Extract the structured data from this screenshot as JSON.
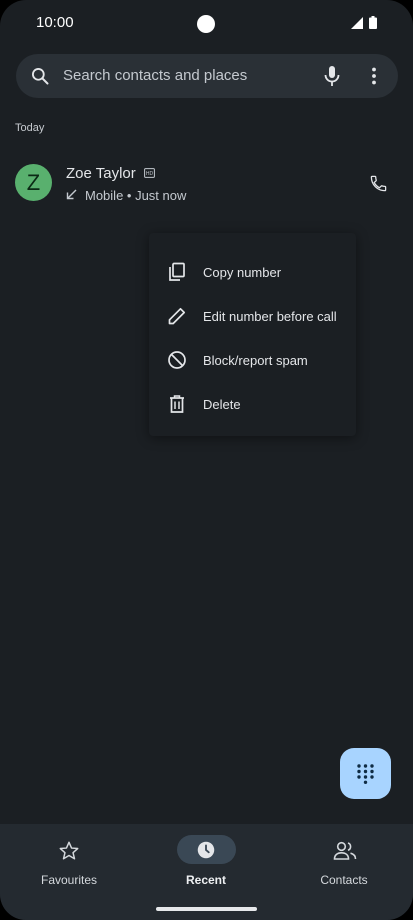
{
  "status_bar": {
    "time": "10:00"
  },
  "search": {
    "placeholder": "Search contacts and places"
  },
  "section": {
    "header": "Today"
  },
  "call_log": {
    "entries": [
      {
        "avatar_letter": "Z",
        "name": "Zoe Taylor",
        "type": "Mobile",
        "time": "Just now",
        "detail": "Mobile • Just now",
        "direction_icon": "incoming-call-arrow"
      }
    ]
  },
  "context_menu": {
    "items": [
      {
        "label": "Copy number",
        "icon": "copy-icon"
      },
      {
        "label": "Edit number before call",
        "icon": "edit-icon"
      },
      {
        "label": "Block/report spam",
        "icon": "block-icon"
      },
      {
        "label": "Delete",
        "icon": "delete-icon"
      }
    ]
  },
  "nav": {
    "items": [
      {
        "label": "Favourites",
        "icon": "star-icon",
        "active": false
      },
      {
        "label": "Recent",
        "icon": "clock-icon",
        "active": true
      },
      {
        "label": "Contacts",
        "icon": "people-icon",
        "active": false
      }
    ]
  },
  "colors": {
    "background": "#1b1f23",
    "search_bar": "#2a3036",
    "avatar": "#59b06e",
    "fab": "#a8d4ff",
    "nav_background": "#242a30",
    "active_pill": "#3a4855"
  }
}
